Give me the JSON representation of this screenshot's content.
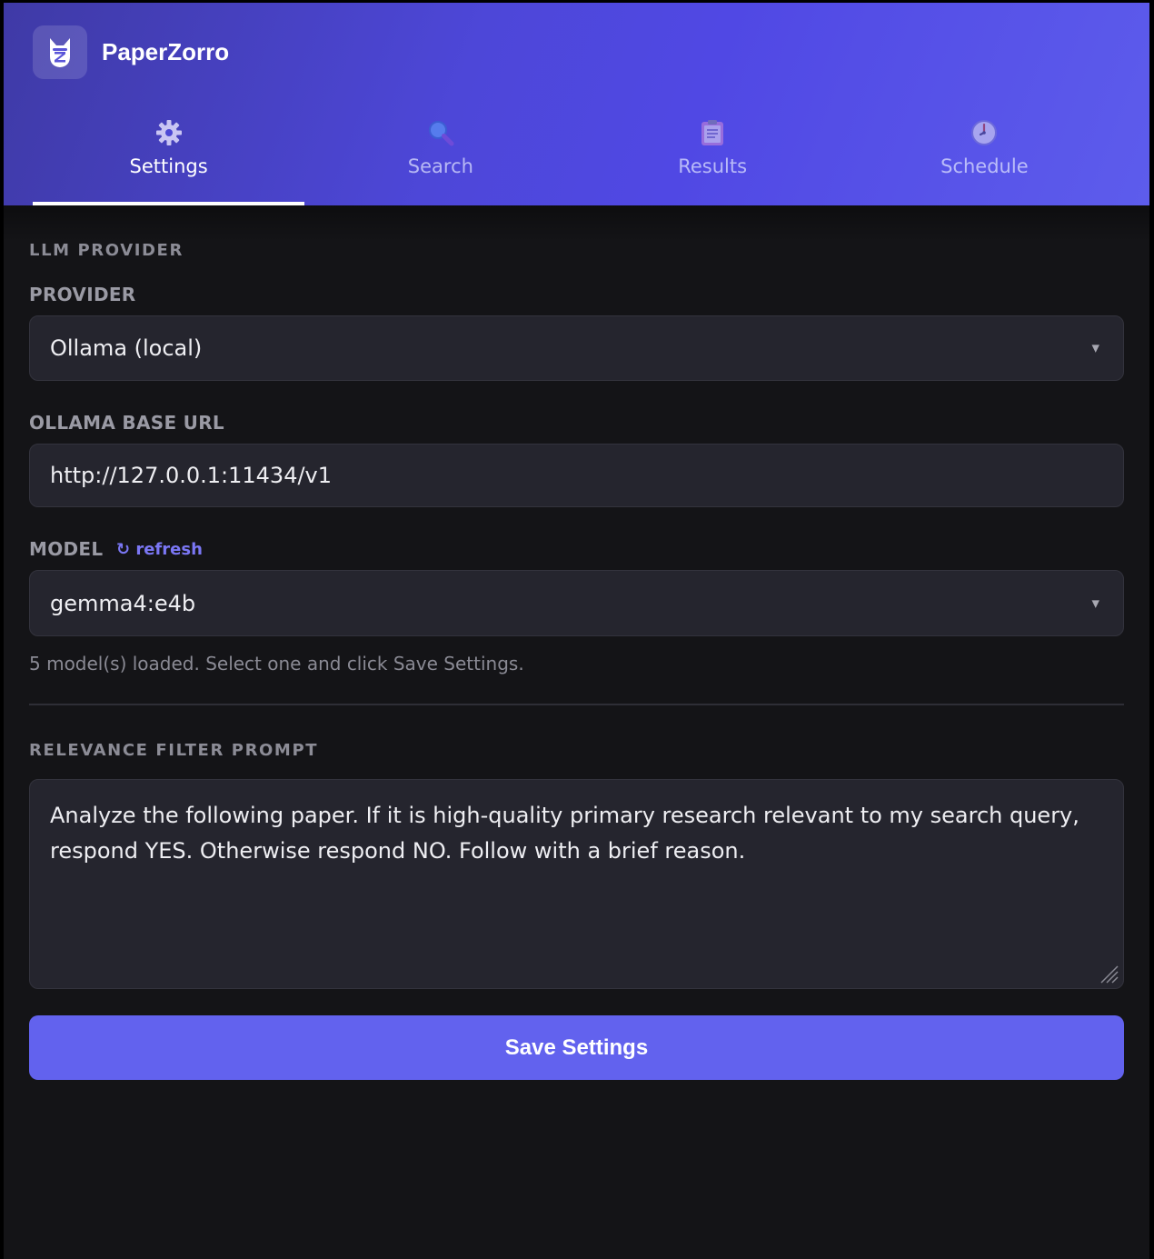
{
  "app": {
    "name": "PaperZorro"
  },
  "tabs": [
    {
      "label": "Settings",
      "icon": "gear-icon",
      "active": true
    },
    {
      "label": "Search",
      "icon": "magnifier-icon",
      "active": false
    },
    {
      "label": "Results",
      "icon": "clipboard-icon",
      "active": false
    },
    {
      "label": "Schedule",
      "icon": "clock-icon",
      "active": false
    }
  ],
  "settings": {
    "section_llm": "LLM PROVIDER",
    "provider": {
      "label": "PROVIDER",
      "value": "Ollama (local)"
    },
    "base_url": {
      "label": "OLLAMA BASE URL",
      "value": "http://127.0.0.1:11434/v1"
    },
    "model": {
      "label": "MODEL",
      "refresh_label": "↻ refresh",
      "value": "gemma4:e4b",
      "hint": "5 model(s) loaded. Select one and click Save Settings."
    },
    "section_prompt": "RELEVANCE FILTER PROMPT",
    "prompt_text": "Analyze the following paper. If it is high-quality primary research relevant to my search query, respond YES. Otherwise respond NO. Follow with a brief reason.",
    "save_label": "Save Settings"
  },
  "colors": {
    "accent": "#6262ee",
    "header_start": "#3f3aa6",
    "header_end": "#5d5cec",
    "background": "#141417",
    "field_bg": "#25252e",
    "link": "#7b77f5"
  }
}
